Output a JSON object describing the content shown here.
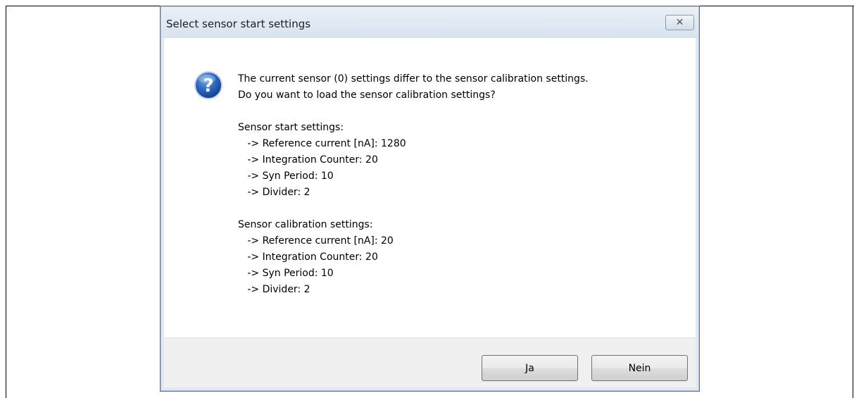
{
  "dialog": {
    "title": "Select sensor start settings",
    "close_icon": "close-icon",
    "icon": "question-icon",
    "message_lines": [
      "The current sensor (0) settings differ to the sensor calibration settings.",
      "Do you want to load the sensor calibration settings?"
    ],
    "start_settings": {
      "heading": "Sensor start settings:",
      "items": [
        "   -> Reference current [nA]: 1280",
        "   -> Integration Counter: 20",
        "   -> Syn Period: 10",
        "   -> Divider: 2"
      ]
    },
    "calibration_settings": {
      "heading": "Sensor calibration settings:",
      "items": [
        "   -> Reference current [nA]: 20",
        "   -> Integration Counter: 20",
        "   -> Syn Period: 10",
        "   -> Divider: 2"
      ]
    },
    "buttons": {
      "yes_label": "Ja",
      "no_label": "Nein"
    },
    "colors": {
      "icon_blue": "#1f5fb4",
      "title_bg": "#dce6f2"
    }
  }
}
